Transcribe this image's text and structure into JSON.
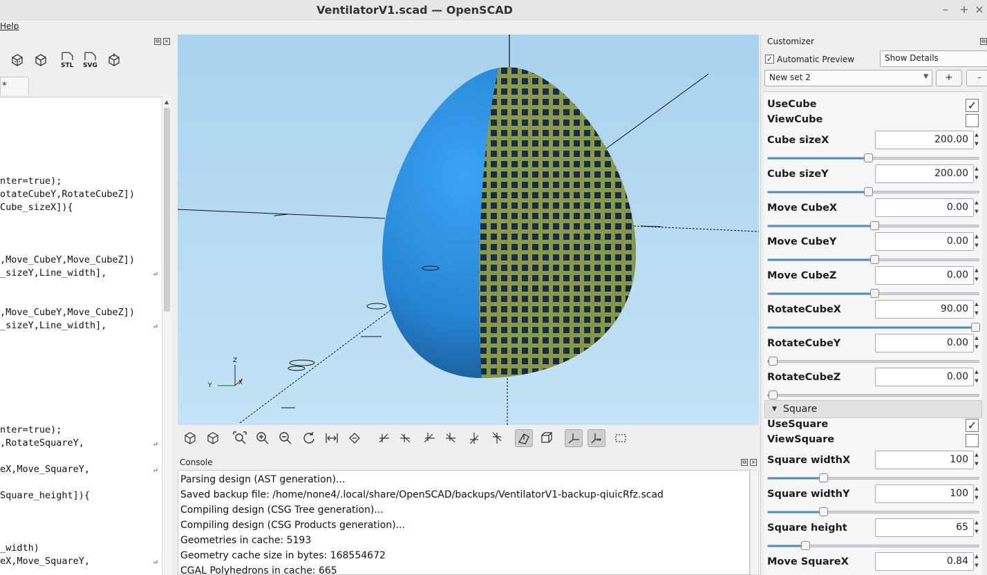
{
  "window": {
    "title": "VentilatorV1.scad — OpenSCAD",
    "minimize": "–",
    "maximize": "+",
    "close": "×"
  },
  "menu": {
    "help": "Help"
  },
  "editor": {
    "tab_label": "*",
    "lines": [
      {
        "text": "nter=true);",
        "wrap": false
      },
      {
        "text": "otateCubeY,RotateCubeZ])",
        "wrap": false
      },
      {
        "text": "Cube_sizeX]){",
        "wrap": false
      },
      {
        "text": ",Move_CubeY,Move_CubeZ])",
        "wrap": false
      },
      {
        "text": "_sizeY,Line_width],",
        "wrap": true
      },
      {
        "text": ",Move_CubeY,Move_CubeZ])",
        "wrap": false
      },
      {
        "text": "_sizeY,Line_width],",
        "wrap": true
      },
      {
        "text": "nter=true);",
        "wrap": false
      },
      {
        "text": ",RotateSquareY,",
        "wrap": true
      },
      {
        "text": "eX,Move_SquareY,",
        "wrap": true
      },
      {
        "text": "Square_height]){",
        "wrap": false
      },
      {
        "text": "_width)",
        "wrap": false
      },
      {
        "text": "eX,Move_SquareY,",
        "wrap": true
      }
    ]
  },
  "viewport": {
    "axis_labels": {
      "z": "Z",
      "y": "Y",
      "x": "X"
    }
  },
  "console": {
    "title": "Console",
    "lines": [
      "Parsing design (AST generation)...",
      "Saved backup file: /home/none4/.local/share/OpenSCAD/backups/VentilatorV1-backup-qiuicRfz.scad",
      "Compiling design (CSG Tree generation)...",
      "Compiling design (CSG Products generation)...",
      "Geometries in cache: 5193",
      "Geometry cache size in bytes: 168554672",
      "CGAL Polyhedrons in cache: 665"
    ]
  },
  "customizer": {
    "title": "Customizer",
    "automatic_preview": "Automatic Preview",
    "automatic_preview_checked": true,
    "details_mode": "Show Details",
    "preset": "New set 2",
    "add_label": "+",
    "remove_label": "-",
    "params": [
      {
        "type": "check",
        "label": "UseCube",
        "checked": true
      },
      {
        "type": "check",
        "label": "ViewCube",
        "checked": false
      },
      {
        "type": "spin",
        "label": "Cube sizeX",
        "value": "200.00",
        "level": 0.47
      },
      {
        "type": "spin",
        "label": "Cube sizeY",
        "value": "200.00",
        "level": 0.47
      },
      {
        "type": "spin",
        "label": "Move CubeX",
        "value": "0.00",
        "level": 0.5
      },
      {
        "type": "spin",
        "label": "Move CubeY",
        "value": "0.00",
        "level": 0.5
      },
      {
        "type": "spin",
        "label": "Move CubeZ",
        "value": "0.00",
        "level": 0.5
      },
      {
        "type": "spin",
        "label": "RotateCubeX",
        "value": "90.00",
        "level": 1.0
      },
      {
        "type": "spin",
        "label": "RotateCubeY",
        "value": "0.00",
        "level": 0.0
      },
      {
        "type": "spin",
        "label": "RotateCubeZ",
        "value": "0.00",
        "level": 0.0
      },
      {
        "type": "group",
        "label": "Square"
      },
      {
        "type": "check",
        "label": "UseSquare",
        "checked": true
      },
      {
        "type": "check",
        "label": "ViewSquare",
        "checked": false
      },
      {
        "type": "spin",
        "label": "Square widthX",
        "value": "100",
        "level": 0.25
      },
      {
        "type": "spin",
        "label": "Square widthY",
        "value": "100",
        "level": 0.25
      },
      {
        "type": "spin",
        "label": "Square height",
        "value": "65",
        "level": 0.16
      },
      {
        "type": "spin",
        "label": "Move SquareX",
        "value": "0.84",
        "level": 0.5
      }
    ]
  },
  "colors": {
    "accent": "#3a8fd9",
    "egg": "#2b8fe0",
    "grid": "#a6b04a"
  }
}
